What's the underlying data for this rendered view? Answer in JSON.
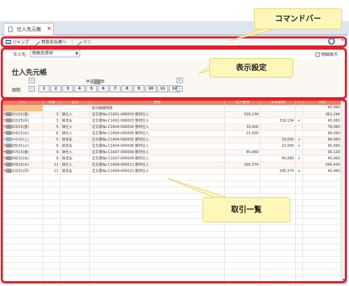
{
  "tab": {
    "title": "仕入先元帳",
    "close_label": "×"
  },
  "toolbar": {
    "jump_label": "ジャンプ",
    "purchase_label": "買掛支払帳へ",
    "edit_label": "修正"
  },
  "filter": {
    "supplier_label": "仕入先:",
    "supplier_value": "梅高岳資材",
    "detail_label": "明細表示"
  },
  "setting": {
    "page_title": "仕入先元帳",
    "period_label": "期間:",
    "era_label": "平成▒▒年",
    "months": [
      "1",
      "2",
      "3",
      "4",
      "5",
      "6",
      "7",
      "8",
      "9",
      "10",
      "11",
      "12"
    ]
  },
  "table": {
    "headers": [
      "日付",
      "伝番",
      "区分",
      "摘要",
      "仕入金額",
      "支払金額",
      "レ",
      "残高"
    ],
    "rows": [
      {
        "date": "",
        "no": "",
        "kubun": "",
        "desc": "前月繰越残高",
        "purchase": "",
        "payment": "",
        "check": "",
        "balance": "45,060"
      },
      {
        "date": "H▒▒/01/15(金)",
        "no": "3",
        "kubun": "掛仕入",
        "desc": "注文書No.C1601-000003 部材仕入",
        "purchase": "316,134",
        "payment": "",
        "check": "",
        "balance": "361,194"
      },
      {
        "date": "H▒▒/02/25(月)",
        "no": "3",
        "kubun": "掛支払",
        "desc": "注文書No.C1601-000003 部材仕入",
        "purchase": "",
        "payment": "316,134",
        "check": "✔",
        "balance": "45,060"
      },
      {
        "date": "H▒▒/03/15(金)",
        "no": "5",
        "kubun": "掛仕入",
        "desc": "注文書No.C1604-000004 部材仕入",
        "purchase": "33,000",
        "payment": "",
        "check": "",
        "balance": "78,060"
      },
      {
        "date": "H▒▒/04/15(水)",
        "no": "6",
        "kubun": "掛仕入",
        "desc": "注文書No.C1604-000006 部材仕入",
        "purchase": "21,000",
        "payment": "",
        "check": "",
        "balance": "99,060"
      },
      {
        "date": "H▒▒/04/30(土)",
        "no": "5",
        "kubun": "掛支払",
        "desc": "注文書No.C1604-000005 部材仕入",
        "purchase": "",
        "payment": "33,000",
        "check": "✔",
        "balance": "66,060"
      },
      {
        "date": "H▒▒/05/31(火)",
        "no": "6",
        "kubun": "掛支払",
        "desc": "注文書No.C1604-000006 部材仕入",
        "purchase": "",
        "payment": "21,000",
        "check": "✔",
        "balance": "45,060"
      },
      {
        "date": "H▒▒/07/15(金)",
        "no": "9",
        "kubun": "掛仕入",
        "desc": "注文書No.C1607-000009 部材仕入",
        "purchase": "45,060",
        "payment": "",
        "check": "",
        "balance": "90,120"
      },
      {
        "date": "H▒▒/08/31(水)",
        "no": "9",
        "kubun": "掛支払",
        "desc": "注文書No.C1607-000009 部材仕入",
        "purchase": "",
        "payment": "45,060",
        "check": "✔",
        "balance": "45,060"
      },
      {
        "date": "H▒▒/09/15(木)",
        "no": "11",
        "kubun": "掛仕入",
        "desc": "注文書No.C1609-000011 部材仕入",
        "purchase": "295,374",
        "payment": "",
        "check": "",
        "balance": "340,434"
      },
      {
        "date": "H▒▒/10/31(月)",
        "no": "11",
        "kubun": "掛支払",
        "desc": "注文書No.C1609-000011 部材仕入",
        "purchase": "",
        "payment": "295,374",
        "check": "✔",
        "balance": "45,060"
      }
    ]
  },
  "callouts": {
    "command": "コマンドバー",
    "setting": "表示設定",
    "list": "取引一覧"
  }
}
